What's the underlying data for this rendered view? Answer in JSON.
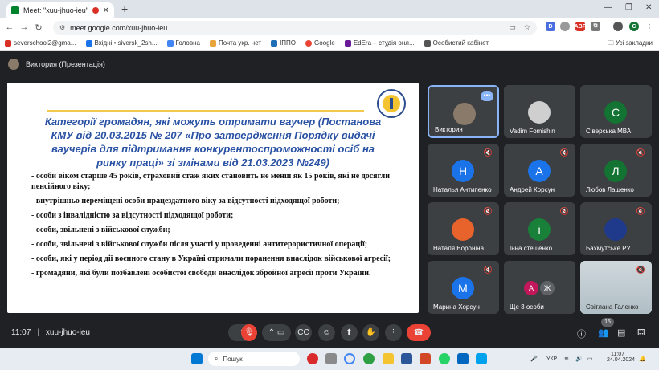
{
  "browser": {
    "tab_title": "Meet: \"xuu-jhuo-ieu\"",
    "url": "meet.google.com/xuu-jhuo-ieu",
    "new_tab": "+",
    "bookmarks": [
      "severschool2@gma...",
      "Вхідні • siversk_2sh...",
      "Головна",
      "Почта укр. нет",
      "ІППО",
      "Google",
      "EdEra – студія онл...",
      "Особистий кабінет"
    ],
    "all_bookmarks": "Усі закладки",
    "profile_initial": "C"
  },
  "meet": {
    "presenter_label": "Виктория (Презентація)",
    "meeting_time": "11:07",
    "meeting_code": "xuu-jhuo-ieu",
    "participants_count": "15"
  },
  "slide": {
    "title": "Категорії громадян, які можуть отримати ваучер (Постанова КМУ від 20.03.2015 № 207 «Про затвердження Порядку видачі ваучерів для підтримання конкурентоспроможності осіб на ринку праці» зі змінами від 21.03.2023 №249)",
    "items": [
      "- особи віком старше 45 років, страховий стаж яких становить не менш як 15 років, які не досягли пенсійного віку;",
      "- внутрішньо переміщені особи працездатного віку за відсутності підходящої роботи;",
      "- особи з інвалідністю за відсутності підходящої роботи;",
      "- особи, звільнені з військової служби;",
      "- особи, звільнені з військової служби після участі у проведенні антитерористичної операції;",
      "- особи, які у період дії воєнного стану в Україні отримали поранення внаслідок військової агресії;",
      "- громадяни, які були позбавлені особистої свободи внаслідок збройної агресії проти України."
    ]
  },
  "participants": [
    {
      "name": "Виктория",
      "initial": "",
      "color": "#8a7a6a"
    },
    {
      "name": "Vadim Fomishin",
      "initial": "",
      "color": "#cfcfcf"
    },
    {
      "name": "Сіверська МВА",
      "initial": "С",
      "color": "#137333"
    },
    {
      "name": "Наталья Антипенко",
      "initial": "Н",
      "color": "#1a73e8"
    },
    {
      "name": "Андрей Корсун",
      "initial": "А",
      "color": "#1a73e8"
    },
    {
      "name": "Любов Лащенко",
      "initial": "Л",
      "color": "#137333"
    },
    {
      "name": "Наталя Вороніна",
      "initial": "",
      "color": "#e8622c"
    },
    {
      "name": "Інна стешенко",
      "initial": "і",
      "color": "#188038"
    },
    {
      "name": "Бахмутське РУ",
      "initial": "",
      "color": "#1f3a8a"
    },
    {
      "name": "Марина Хорсун",
      "initial": "М",
      "color": "#1a73e8"
    },
    {
      "name": "Ще 3 особи",
      "initial": "",
      "color": "#3c4043"
    },
    {
      "name": "Світлана Галенко",
      "initial": "",
      "color": "#b9c6cf"
    }
  ],
  "more_initials": [
    "А",
    "Ж"
  ],
  "taskbar": {
    "search_placeholder": "Пошук",
    "lang": "УКР",
    "time": "11:07",
    "date": "24.04.2024"
  }
}
